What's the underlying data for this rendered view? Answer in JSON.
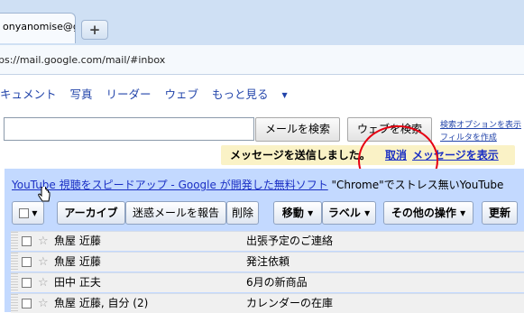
{
  "browser": {
    "tab_title": "onyanomise@g...",
    "new_tab_label": "+",
    "url": "ps://mail.google.com/mail/#inbox"
  },
  "nav": {
    "items": [
      "キュメント",
      "写真",
      "リーダー",
      "ウェブ"
    ],
    "more": "もっと見る",
    "more_caret": "▼"
  },
  "search": {
    "input_value": "",
    "mail_search_label": "メールを検索",
    "web_search_label": "ウェブを検索",
    "search_options_label": "検索オプションを表示",
    "create_filter_label": "フィルタを作成"
  },
  "notice": {
    "message": "メッセージを送信しました。",
    "undo": "取消",
    "view": "メッセージを表示"
  },
  "webclip": {
    "link": "YouTube 視聴をスピードアップ - Google が開発した無料ソフト",
    "text": " \"Chrome\"でストレス無いYouTube"
  },
  "toolbar": {
    "select_caret": "▾",
    "archive": "アーカイブ",
    "report_spam": "迷惑メールを報告",
    "delete": "削除",
    "move": "移動 ▾",
    "labels": "ラベル ▾",
    "more_actions": "その他の操作 ▾",
    "refresh": "更新"
  },
  "emails": [
    {
      "sender": "魚屋 近藤",
      "subject": "出張予定のご連絡"
    },
    {
      "sender": "魚屋 近藤",
      "subject": "発注依頼"
    },
    {
      "sender": "田中 正夫",
      "subject": "6月の新商品"
    },
    {
      "sender": "魚屋 近藤, 自分 (2)",
      "subject": "カレンダーの在庫"
    }
  ],
  "colors": {
    "panel": "#c3d9ff",
    "notice_bg": "#faf2c6",
    "link": "#1a2fc4",
    "annotation_circle": "#e60012"
  }
}
